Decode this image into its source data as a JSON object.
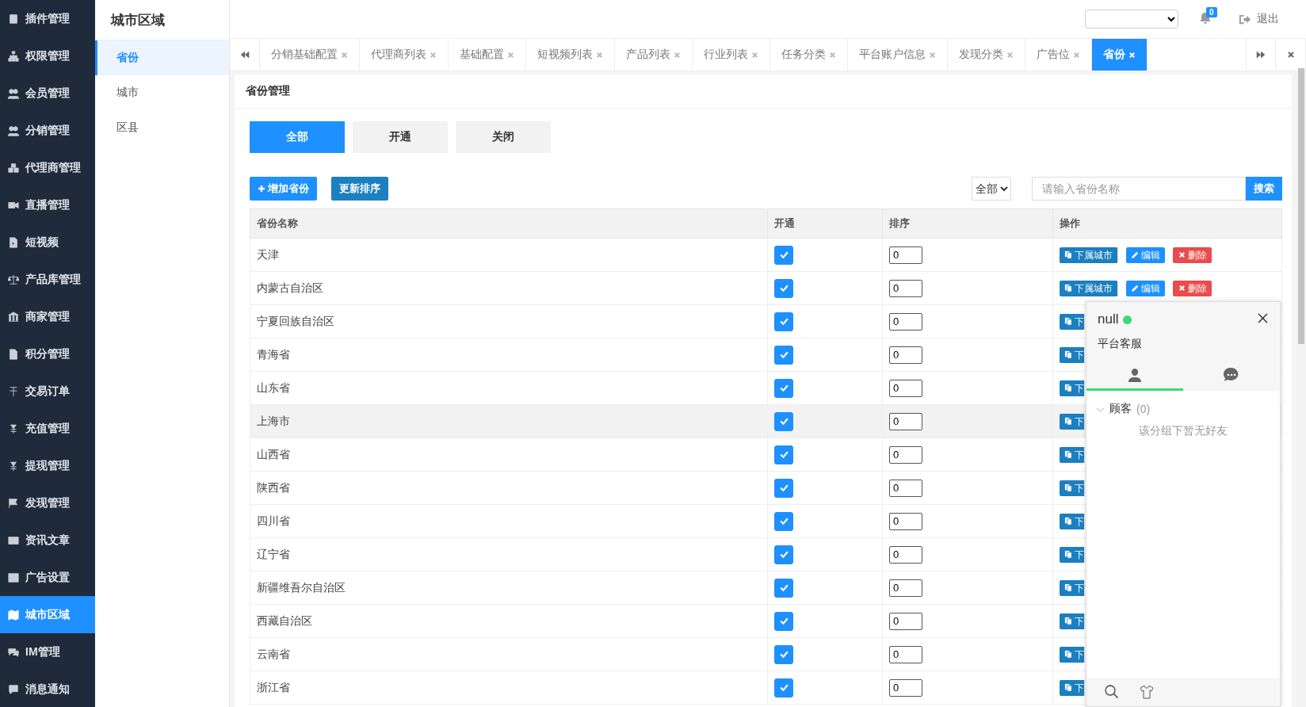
{
  "sidebar": {
    "items": [
      {
        "label": "插件管理",
        "selected": false
      },
      {
        "label": "权限管理",
        "selected": false
      },
      {
        "label": "会员管理",
        "selected": false
      },
      {
        "label": "分销管理",
        "selected": false
      },
      {
        "label": "代理商管理",
        "selected": false
      },
      {
        "label": "直播管理",
        "selected": false
      },
      {
        "label": "短视频",
        "selected": false
      },
      {
        "label": "产品库管理",
        "selected": false
      },
      {
        "label": "商家管理",
        "selected": false
      },
      {
        "label": "积分管理",
        "selected": false
      },
      {
        "label": "交易订单",
        "selected": false
      },
      {
        "label": "充值管理",
        "selected": false
      },
      {
        "label": "提现管理",
        "selected": false
      },
      {
        "label": "发现管理",
        "selected": false
      },
      {
        "label": "资讯文章",
        "selected": false
      },
      {
        "label": "广告设置",
        "selected": false
      },
      {
        "label": "城市区域",
        "selected": true
      },
      {
        "label": "IM管理",
        "selected": false
      },
      {
        "label": "消息通知",
        "selected": false
      }
    ]
  },
  "submenu": {
    "title": "城市区域",
    "items": [
      {
        "label": "省份",
        "selected": true
      },
      {
        "label": "城市",
        "selected": false
      },
      {
        "label": "区县",
        "selected": false
      }
    ]
  },
  "topbar": {
    "notification_count": "0",
    "logout": "退出"
  },
  "tabs": [
    {
      "label": "分销基础配置",
      "selected": false
    },
    {
      "label": "代理商列表",
      "selected": false
    },
    {
      "label": "基础配置",
      "selected": false
    },
    {
      "label": "短视频列表",
      "selected": false
    },
    {
      "label": "产品列表",
      "selected": false
    },
    {
      "label": "行业列表",
      "selected": false
    },
    {
      "label": "任务分类",
      "selected": false
    },
    {
      "label": "平台账户信息",
      "selected": false
    },
    {
      "label": "发现分类",
      "selected": false
    },
    {
      "label": "广告位",
      "selected": false
    },
    {
      "label": "省份",
      "selected": true
    }
  ],
  "panel": {
    "title": "省份管理",
    "filters": [
      {
        "label": "全部",
        "selected": true
      },
      {
        "label": "开通",
        "selected": false
      },
      {
        "label": "关闭",
        "selected": false
      }
    ],
    "add_button": "增加省份",
    "sort_button": "更新排序",
    "status_select": "全部",
    "search": {
      "placeholder": "请输入省份名称",
      "button": "搜索"
    },
    "columns": [
      "省份名称",
      "开通",
      "排序",
      "操作"
    ],
    "rows": [
      {
        "name": "天津",
        "on": true,
        "sort": "0",
        "selected": false,
        "actions": [
          {
            "kind": "sub",
            "label": "下属城市"
          },
          {
            "kind": "edit",
            "label": "编辑"
          },
          {
            "kind": "delete",
            "label": "删除"
          }
        ]
      },
      {
        "name": "内蒙古自治区",
        "on": true,
        "sort": "0",
        "selected": false,
        "actions": [
          {
            "kind": "sub",
            "label": "下属城市"
          },
          {
            "kind": "edit",
            "label": "编辑"
          },
          {
            "kind": "delete",
            "label": "删除"
          }
        ]
      },
      {
        "name": "宁夏回族自治区",
        "on": true,
        "sort": "0",
        "selected": false,
        "actions": [
          {
            "kind": "sub",
            "label": "下"
          }
        ]
      },
      {
        "name": "青海省",
        "on": true,
        "sort": "0",
        "selected": false,
        "actions": [
          {
            "kind": "sub",
            "label": "下"
          }
        ]
      },
      {
        "name": "山东省",
        "on": true,
        "sort": "0",
        "selected": false,
        "actions": [
          {
            "kind": "sub",
            "label": "下"
          }
        ]
      },
      {
        "name": "上海市",
        "on": true,
        "sort": "0",
        "selected": true,
        "actions": [
          {
            "kind": "sub",
            "label": "下"
          }
        ]
      },
      {
        "name": "山西省",
        "on": true,
        "sort": "0",
        "selected": false,
        "actions": [
          {
            "kind": "sub",
            "label": "下"
          }
        ]
      },
      {
        "name": "陕西省",
        "on": true,
        "sort": "0",
        "selected": false,
        "actions": [
          {
            "kind": "sub",
            "label": "下"
          }
        ]
      },
      {
        "name": "四川省",
        "on": true,
        "sort": "0",
        "selected": false,
        "actions": [
          {
            "kind": "sub",
            "label": "下"
          }
        ]
      },
      {
        "name": "辽宁省",
        "on": true,
        "sort": "0",
        "selected": false,
        "actions": [
          {
            "kind": "sub",
            "label": "下"
          }
        ]
      },
      {
        "name": "新疆维吾尔自治区",
        "on": true,
        "sort": "0",
        "selected": false,
        "actions": [
          {
            "kind": "sub",
            "label": "下"
          }
        ]
      },
      {
        "name": "西藏自治区",
        "on": true,
        "sort": "0",
        "selected": false,
        "actions": [
          {
            "kind": "sub",
            "label": "下"
          }
        ]
      },
      {
        "name": "云南省",
        "on": true,
        "sort": "0",
        "selected": false,
        "actions": [
          {
            "kind": "sub",
            "label": "下"
          }
        ]
      },
      {
        "name": "浙江省",
        "on": true,
        "sort": "0",
        "selected": false,
        "actions": [
          {
            "kind": "sub",
            "label": "下"
          }
        ]
      }
    ]
  },
  "chat": {
    "name": "null",
    "online": true,
    "subtitle": "平台客服",
    "tabs": [
      {
        "kind": "contacts",
        "selected": true
      },
      {
        "kind": "chats",
        "selected": false
      }
    ],
    "group": {
      "label": "顾客",
      "count": "(0)",
      "expanded": true,
      "empty_text": "该分组下暂无好友"
    }
  }
}
